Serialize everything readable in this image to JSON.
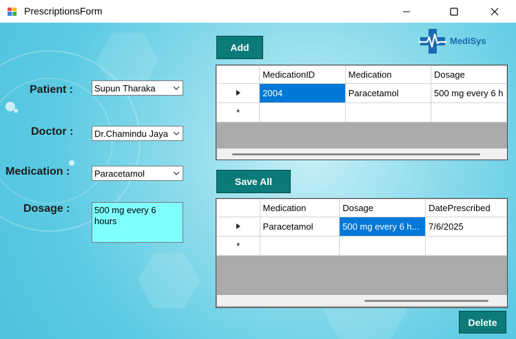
{
  "window": {
    "title": "PrescriptionsForm"
  },
  "brand": {
    "name": "MediSys",
    "color": "#1d68b0"
  },
  "form": {
    "patient_label": "Patient :",
    "patient_value": "Supun Tharaka",
    "doctor_label": "Doctor :",
    "doctor_value": "Dr.Chamindu Jaya",
    "medication_label": "Medication :",
    "medication_value": "Paracetamol",
    "dosage_label": "Dosage :",
    "dosage_value": "500 mg every 6 hours"
  },
  "buttons": {
    "add": "Add",
    "save_all": "Save All",
    "delete": "Delete"
  },
  "medications_grid": {
    "columns": [
      "MedicationID",
      "Medication",
      "Dosage"
    ],
    "rows": [
      [
        "2004",
        "Paracetamol",
        "500 mg every 6 h"
      ]
    ]
  },
  "prescriptions_grid": {
    "columns": [
      "Medication",
      "Dosage",
      "DatePrescribed"
    ],
    "rows": [
      [
        "Paracetamol",
        "500 mg every 6 h...",
        "7/6/2025"
      ]
    ]
  },
  "colors": {
    "button": "#0b7a78",
    "dosage_bg": "#80ffff",
    "selection": "#0078d7",
    "grid_bg": "#ababab"
  }
}
